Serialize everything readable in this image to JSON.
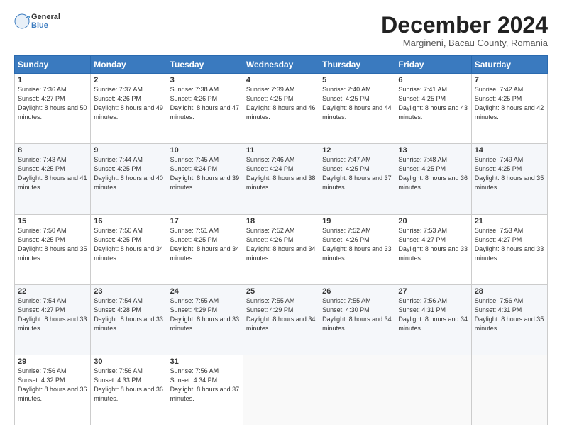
{
  "logo": {
    "line1": "General",
    "line2": "Blue"
  },
  "title": "December 2024",
  "subtitle": "Margineni, Bacau County, Romania",
  "days_header": [
    "Sunday",
    "Monday",
    "Tuesday",
    "Wednesday",
    "Thursday",
    "Friday",
    "Saturday"
  ],
  "weeks": [
    [
      {
        "num": "1",
        "rise": "7:36 AM",
        "set": "4:27 PM",
        "daylight": "8 hours and 50 minutes."
      },
      {
        "num": "2",
        "rise": "7:37 AM",
        "set": "4:26 PM",
        "daylight": "8 hours and 49 minutes."
      },
      {
        "num": "3",
        "rise": "7:38 AM",
        "set": "4:26 PM",
        "daylight": "8 hours and 47 minutes."
      },
      {
        "num": "4",
        "rise": "7:39 AM",
        "set": "4:25 PM",
        "daylight": "8 hours and 46 minutes."
      },
      {
        "num": "5",
        "rise": "7:40 AM",
        "set": "4:25 PM",
        "daylight": "8 hours and 44 minutes."
      },
      {
        "num": "6",
        "rise": "7:41 AM",
        "set": "4:25 PM",
        "daylight": "8 hours and 43 minutes."
      },
      {
        "num": "7",
        "rise": "7:42 AM",
        "set": "4:25 PM",
        "daylight": "8 hours and 42 minutes."
      }
    ],
    [
      {
        "num": "8",
        "rise": "7:43 AM",
        "set": "4:25 PM",
        "daylight": "8 hours and 41 minutes."
      },
      {
        "num": "9",
        "rise": "7:44 AM",
        "set": "4:25 PM",
        "daylight": "8 hours and 40 minutes."
      },
      {
        "num": "10",
        "rise": "7:45 AM",
        "set": "4:24 PM",
        "daylight": "8 hours and 39 minutes."
      },
      {
        "num": "11",
        "rise": "7:46 AM",
        "set": "4:24 PM",
        "daylight": "8 hours and 38 minutes."
      },
      {
        "num": "12",
        "rise": "7:47 AM",
        "set": "4:25 PM",
        "daylight": "8 hours and 37 minutes."
      },
      {
        "num": "13",
        "rise": "7:48 AM",
        "set": "4:25 PM",
        "daylight": "8 hours and 36 minutes."
      },
      {
        "num": "14",
        "rise": "7:49 AM",
        "set": "4:25 PM",
        "daylight": "8 hours and 35 minutes."
      }
    ],
    [
      {
        "num": "15",
        "rise": "7:50 AM",
        "set": "4:25 PM",
        "daylight": "8 hours and 35 minutes."
      },
      {
        "num": "16",
        "rise": "7:50 AM",
        "set": "4:25 PM",
        "daylight": "8 hours and 34 minutes."
      },
      {
        "num": "17",
        "rise": "7:51 AM",
        "set": "4:25 PM",
        "daylight": "8 hours and 34 minutes."
      },
      {
        "num": "18",
        "rise": "7:52 AM",
        "set": "4:26 PM",
        "daylight": "8 hours and 34 minutes."
      },
      {
        "num": "19",
        "rise": "7:52 AM",
        "set": "4:26 PM",
        "daylight": "8 hours and 33 minutes."
      },
      {
        "num": "20",
        "rise": "7:53 AM",
        "set": "4:27 PM",
        "daylight": "8 hours and 33 minutes."
      },
      {
        "num": "21",
        "rise": "7:53 AM",
        "set": "4:27 PM",
        "daylight": "8 hours and 33 minutes."
      }
    ],
    [
      {
        "num": "22",
        "rise": "7:54 AM",
        "set": "4:27 PM",
        "daylight": "8 hours and 33 minutes."
      },
      {
        "num": "23",
        "rise": "7:54 AM",
        "set": "4:28 PM",
        "daylight": "8 hours and 33 minutes."
      },
      {
        "num": "24",
        "rise": "7:55 AM",
        "set": "4:29 PM",
        "daylight": "8 hours and 33 minutes."
      },
      {
        "num": "25",
        "rise": "7:55 AM",
        "set": "4:29 PM",
        "daylight": "8 hours and 34 minutes."
      },
      {
        "num": "26",
        "rise": "7:55 AM",
        "set": "4:30 PM",
        "daylight": "8 hours and 34 minutes."
      },
      {
        "num": "27",
        "rise": "7:56 AM",
        "set": "4:31 PM",
        "daylight": "8 hours and 34 minutes."
      },
      {
        "num": "28",
        "rise": "7:56 AM",
        "set": "4:31 PM",
        "daylight": "8 hours and 35 minutes."
      }
    ],
    [
      {
        "num": "29",
        "rise": "7:56 AM",
        "set": "4:32 PM",
        "daylight": "8 hours and 36 minutes."
      },
      {
        "num": "30",
        "rise": "7:56 AM",
        "set": "4:33 PM",
        "daylight": "8 hours and 36 minutes."
      },
      {
        "num": "31",
        "rise": "7:56 AM",
        "set": "4:34 PM",
        "daylight": "8 hours and 37 minutes."
      },
      null,
      null,
      null,
      null
    ]
  ]
}
